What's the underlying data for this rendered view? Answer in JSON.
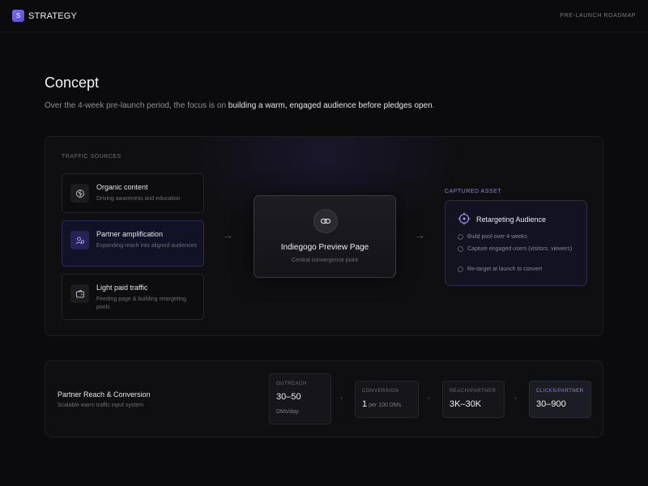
{
  "header": {
    "brand_letter": "S",
    "brand_name": "STRATEGY",
    "right_label": "PRE-LAUNCH ROADMAP"
  },
  "concept": {
    "title": "Concept",
    "desc_prefix": "Over the 4-week pre-launch period, the focus is on ",
    "desc_bold": "building a warm, engaged audience before pledges open",
    "desc_suffix": "."
  },
  "traffic": {
    "label": "TRAFFIC SOURCES",
    "sources": [
      {
        "title": "Organic content",
        "subtitle": "Driving awareness and education",
        "icon": "leaf-icon"
      },
      {
        "title": "Partner amplification",
        "subtitle": "Expanding reach into aligned audiences",
        "icon": "partners-icon"
      },
      {
        "title": "Light paid traffic",
        "subtitle": "Feeding page & building retargeting pools",
        "icon": "wallet-icon"
      }
    ]
  },
  "center": {
    "title": "Indiegogo Preview Page",
    "subtitle": "Central convergence point",
    "icon": "link-icon"
  },
  "captured": {
    "label": "CAPTURED ASSET",
    "title": "Retargeting Audience",
    "icon": "target-icon",
    "items": [
      "Build pool over 4 weeks",
      "Capture engaged users (visitors, viewers)",
      "Re-target at launch to convert"
    ]
  },
  "reach": {
    "title": "Partner Reach & Conversion",
    "subtitle": "Scalable warm traffic input system",
    "metrics": [
      {
        "label": "OUTREACH",
        "value": "30–50",
        "unit": "DMs/day"
      },
      {
        "label": "CONVERSION",
        "value": "1",
        "value_small": "per 100 DMs"
      },
      {
        "label": "REACH/PARTNER",
        "value": "3K–30K"
      },
      {
        "label": "CLICKS/PARTNER",
        "value": "30–900"
      }
    ]
  },
  "colors": {
    "accent": "#8f82f0",
    "background": "#0b0b0d",
    "card": "#0f0f12"
  }
}
